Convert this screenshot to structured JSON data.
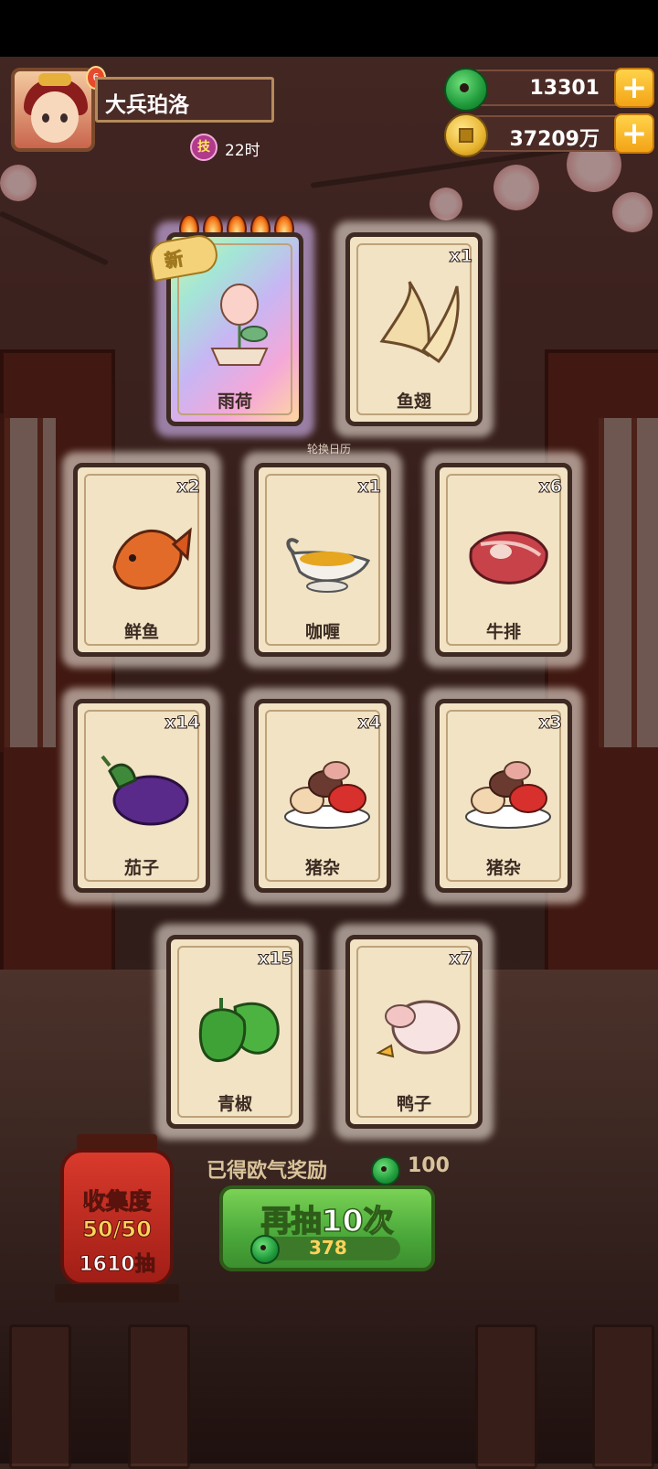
{
  "player": {
    "name": "大兵珀洛",
    "level": "6",
    "skill_icon": "技",
    "skill_time": "22时"
  },
  "currency": {
    "jade": "13301",
    "coins": "37209万",
    "plus": "+"
  },
  "banner_subtext": "轮换日历",
  "cards": [
    {
      "name": "雨荷",
      "count": "",
      "is_new": true,
      "new_label": "新",
      "flames": 5,
      "icon": "lotus-icon"
    },
    {
      "name": "鱼翅",
      "count": "x1",
      "icon": "shark-fin-icon"
    },
    {
      "name": "鲜鱼",
      "count": "x2",
      "icon": "fish-icon"
    },
    {
      "name": "咖喱",
      "count": "x1",
      "icon": "curry-icon"
    },
    {
      "name": "牛排",
      "count": "x6",
      "icon": "steak-icon"
    },
    {
      "name": "茄子",
      "count": "x14",
      "icon": "eggplant-icon"
    },
    {
      "name": "猪杂",
      "count": "x4",
      "icon": "pork-offal-icon"
    },
    {
      "name": "猪杂",
      "count": "x3",
      "icon": "pork-offal-icon"
    },
    {
      "name": "青椒",
      "count": "x15",
      "icon": "green-pepper-icon"
    },
    {
      "name": "鸭子",
      "count": "x7",
      "icon": "duck-icon"
    }
  ],
  "collection": {
    "title": "收集度",
    "progress": "50/50",
    "draws": "1610抽"
  },
  "luck_reward": {
    "label": "已得欧气奖励",
    "value": "100"
  },
  "draw_button": {
    "label": "再抽10次",
    "cost": "378"
  }
}
